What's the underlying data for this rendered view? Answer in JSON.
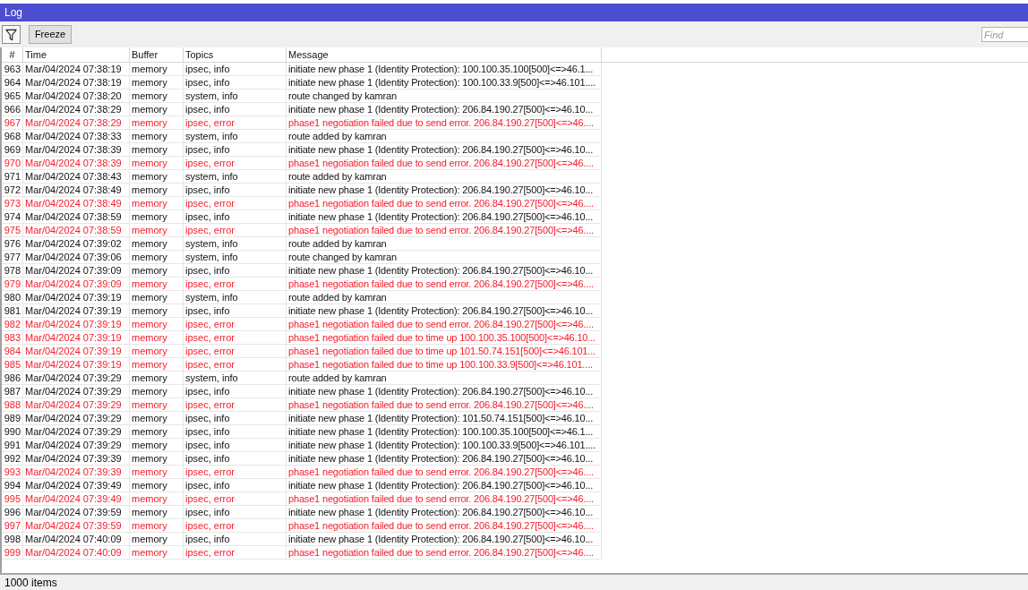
{
  "window": {
    "title": "Log"
  },
  "toolbar": {
    "freeze_button": "Freeze",
    "find": {
      "placeholder": "Find"
    }
  },
  "table": {
    "columns": [
      "#",
      "Time",
      "Buffer",
      "Topics",
      "Message"
    ],
    "rows": [
      {
        "number": "963",
        "time": "Mar/04/2024 07:38:19",
        "buffer": "memory",
        "topics": "ipsec, info",
        "message": "initiate new phase 1 (Identity Protection): 100.100.35.100[500]<=>46.1...",
        "error": false
      },
      {
        "number": "964",
        "time": "Mar/04/2024 07:38:19",
        "buffer": "memory",
        "topics": "ipsec, info",
        "message": "initiate new phase 1 (Identity Protection): 100.100.33.9[500]<=>46.101....",
        "error": false
      },
      {
        "number": "965",
        "time": "Mar/04/2024 07:38:20",
        "buffer": "memory",
        "topics": "system, info",
        "message": "route changed by kamran",
        "error": false
      },
      {
        "number": "966",
        "time": "Mar/04/2024 07:38:29",
        "buffer": "memory",
        "topics": "ipsec, info",
        "message": "initiate new phase 1 (Identity Protection): 206.84.190.27[500]<=>46.10...",
        "error": false
      },
      {
        "number": "967",
        "time": "Mar/04/2024 07:38:29",
        "buffer": "memory",
        "topics": "ipsec, error",
        "message": "phase1 negotiation failed due to send error. 206.84.190.27[500]<=>46....",
        "error": true
      },
      {
        "number": "968",
        "time": "Mar/04/2024 07:38:33",
        "buffer": "memory",
        "topics": "system, info",
        "message": "route added by kamran",
        "error": false
      },
      {
        "number": "969",
        "time": "Mar/04/2024 07:38:39",
        "buffer": "memory",
        "topics": "ipsec, info",
        "message": "initiate new phase 1 (Identity Protection): 206.84.190.27[500]<=>46.10...",
        "error": false
      },
      {
        "number": "970",
        "time": "Mar/04/2024 07:38:39",
        "buffer": "memory",
        "topics": "ipsec, error",
        "message": "phase1 negotiation failed due to send error. 206.84.190.27[500]<=>46....",
        "error": true
      },
      {
        "number": "971",
        "time": "Mar/04/2024 07:38:43",
        "buffer": "memory",
        "topics": "system, info",
        "message": "route added by kamran",
        "error": false
      },
      {
        "number": "972",
        "time": "Mar/04/2024 07:38:49",
        "buffer": "memory",
        "topics": "ipsec, info",
        "message": "initiate new phase 1 (Identity Protection): 206.84.190.27[500]<=>46.10...",
        "error": false
      },
      {
        "number": "973",
        "time": "Mar/04/2024 07:38:49",
        "buffer": "memory",
        "topics": "ipsec, error",
        "message": "phase1 negotiation failed due to send error. 206.84.190.27[500]<=>46....",
        "error": true
      },
      {
        "number": "974",
        "time": "Mar/04/2024 07:38:59",
        "buffer": "memory",
        "topics": "ipsec, info",
        "message": "initiate new phase 1 (Identity Protection): 206.84.190.27[500]<=>46.10...",
        "error": false
      },
      {
        "number": "975",
        "time": "Mar/04/2024 07:38:59",
        "buffer": "memory",
        "topics": "ipsec, error",
        "message": "phase1 negotiation failed due to send error. 206.84.190.27[500]<=>46....",
        "error": true
      },
      {
        "number": "976",
        "time": "Mar/04/2024 07:39:02",
        "buffer": "memory",
        "topics": "system, info",
        "message": "route added by kamran",
        "error": false
      },
      {
        "number": "977",
        "time": "Mar/04/2024 07:39:06",
        "buffer": "memory",
        "topics": "system, info",
        "message": "route changed by kamran",
        "error": false
      },
      {
        "number": "978",
        "time": "Mar/04/2024 07:39:09",
        "buffer": "memory",
        "topics": "ipsec, info",
        "message": "initiate new phase 1 (Identity Protection): 206.84.190.27[500]<=>46.10...",
        "error": false
      },
      {
        "number": "979",
        "time": "Mar/04/2024 07:39:09",
        "buffer": "memory",
        "topics": "ipsec, error",
        "message": "phase1 negotiation failed due to send error. 206.84.190.27[500]<=>46....",
        "error": true
      },
      {
        "number": "980",
        "time": "Mar/04/2024 07:39:19",
        "buffer": "memory",
        "topics": "system, info",
        "message": "route added by kamran",
        "error": false
      },
      {
        "number": "981",
        "time": "Mar/04/2024 07:39:19",
        "buffer": "memory",
        "topics": "ipsec, info",
        "message": "initiate new phase 1 (Identity Protection): 206.84.190.27[500]<=>46.10...",
        "error": false
      },
      {
        "number": "982",
        "time": "Mar/04/2024 07:39:19",
        "buffer": "memory",
        "topics": "ipsec, error",
        "message": "phase1 negotiation failed due to send error. 206.84.190.27[500]<=>46....",
        "error": true
      },
      {
        "number": "983",
        "time": "Mar/04/2024 07:39:19",
        "buffer": "memory",
        "topics": "ipsec, error",
        "message": "phase1 negotiation failed due to time up 100.100.35.100[500]<=>46.10...",
        "error": true
      },
      {
        "number": "984",
        "time": "Mar/04/2024 07:39:19",
        "buffer": "memory",
        "topics": "ipsec, error",
        "message": "phase1 negotiation failed due to time up 101.50.74.151[500]<=>46.101...",
        "error": true
      },
      {
        "number": "985",
        "time": "Mar/04/2024 07:39:19",
        "buffer": "memory",
        "topics": "ipsec, error",
        "message": "phase1 negotiation failed due to time up 100.100.33.9[500]<=>46.101....",
        "error": true
      },
      {
        "number": "986",
        "time": "Mar/04/2024 07:39:29",
        "buffer": "memory",
        "topics": "system, info",
        "message": "route added by kamran",
        "error": false
      },
      {
        "number": "987",
        "time": "Mar/04/2024 07:39:29",
        "buffer": "memory",
        "topics": "ipsec, info",
        "message": "initiate new phase 1 (Identity Protection): 206.84.190.27[500]<=>46.10...",
        "error": false
      },
      {
        "number": "988",
        "time": "Mar/04/2024 07:39:29",
        "buffer": "memory",
        "topics": "ipsec, error",
        "message": "phase1 negotiation failed due to send error. 206.84.190.27[500]<=>46....",
        "error": true
      },
      {
        "number": "989",
        "time": "Mar/04/2024 07:39:29",
        "buffer": "memory",
        "topics": "ipsec, info",
        "message": "initiate new phase 1 (Identity Protection): 101.50.74.151[500]<=>46.10...",
        "error": false
      },
      {
        "number": "990",
        "time": "Mar/04/2024 07:39:29",
        "buffer": "memory",
        "topics": "ipsec, info",
        "message": "initiate new phase 1 (Identity Protection): 100.100.35.100[500]<=>46.1...",
        "error": false
      },
      {
        "number": "991",
        "time": "Mar/04/2024 07:39:29",
        "buffer": "memory",
        "topics": "ipsec, info",
        "message": "initiate new phase 1 (Identity Protection): 100.100.33.9[500]<=>46.101....",
        "error": false
      },
      {
        "number": "992",
        "time": "Mar/04/2024 07:39:39",
        "buffer": "memory",
        "topics": "ipsec, info",
        "message": "initiate new phase 1 (Identity Protection): 206.84.190.27[500]<=>46.10...",
        "error": false
      },
      {
        "number": "993",
        "time": "Mar/04/2024 07:39:39",
        "buffer": "memory",
        "topics": "ipsec, error",
        "message": "phase1 negotiation failed due to send error. 206.84.190.27[500]<=>46....",
        "error": true
      },
      {
        "number": "994",
        "time": "Mar/04/2024 07:39:49",
        "buffer": "memory",
        "topics": "ipsec, info",
        "message": "initiate new phase 1 (Identity Protection): 206.84.190.27[500]<=>46.10...",
        "error": false
      },
      {
        "number": "995",
        "time": "Mar/04/2024 07:39:49",
        "buffer": "memory",
        "topics": "ipsec, error",
        "message": "phase1 negotiation failed due to send error. 206.84.190.27[500]<=>46....",
        "error": true
      },
      {
        "number": "996",
        "time": "Mar/04/2024 07:39:59",
        "buffer": "memory",
        "topics": "ipsec, info",
        "message": "initiate new phase 1 (Identity Protection): 206.84.190.27[500]<=>46.10...",
        "error": false
      },
      {
        "number": "997",
        "time": "Mar/04/2024 07:39:59",
        "buffer": "memory",
        "topics": "ipsec, error",
        "message": "phase1 negotiation failed due to send error. 206.84.190.27[500]<=>46....",
        "error": true
      },
      {
        "number": "998",
        "time": "Mar/04/2024 07:40:09",
        "buffer": "memory",
        "topics": "ipsec, info",
        "message": "initiate new phase 1 (Identity Protection): 206.84.190.27[500]<=>46.10...",
        "error": false
      },
      {
        "number": "999",
        "time": "Mar/04/2024 07:40:09",
        "buffer": "memory",
        "topics": "ipsec, error",
        "message": "phase1 negotiation failed due to send error. 206.84.190.27[500]<=>46....",
        "error": true
      }
    ]
  },
  "status_bar": {
    "text": "1000 items"
  }
}
